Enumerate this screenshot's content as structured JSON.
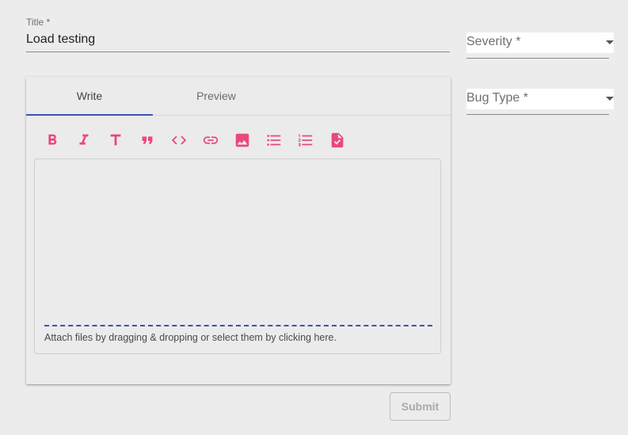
{
  "title_field": {
    "label": "Title *",
    "value": "Load testing"
  },
  "editor": {
    "tabs": [
      {
        "label": "Write",
        "active": true
      },
      {
        "label": "Preview",
        "active": false
      }
    ],
    "toolbar": [
      {
        "icon": "bold-icon"
      },
      {
        "icon": "italic-icon"
      },
      {
        "icon": "header-icon"
      },
      {
        "icon": "quote-icon"
      },
      {
        "icon": "code-icon"
      },
      {
        "icon": "link-icon"
      },
      {
        "icon": "image-icon"
      },
      {
        "icon": "unordered-list-icon"
      },
      {
        "icon": "ordered-list-icon"
      },
      {
        "icon": "checked-list-icon"
      }
    ],
    "content": "",
    "attach_text": "Attach files by dragging & dropping or select them by clicking here."
  },
  "severity": {
    "label": "Severity *",
    "value": ""
  },
  "bug_type": {
    "label": "Bug Type *",
    "value": ""
  },
  "submit_label": "Submit",
  "colors": {
    "accent": "#3f51b5",
    "icon": "#e8497a",
    "background": "#ececec"
  }
}
